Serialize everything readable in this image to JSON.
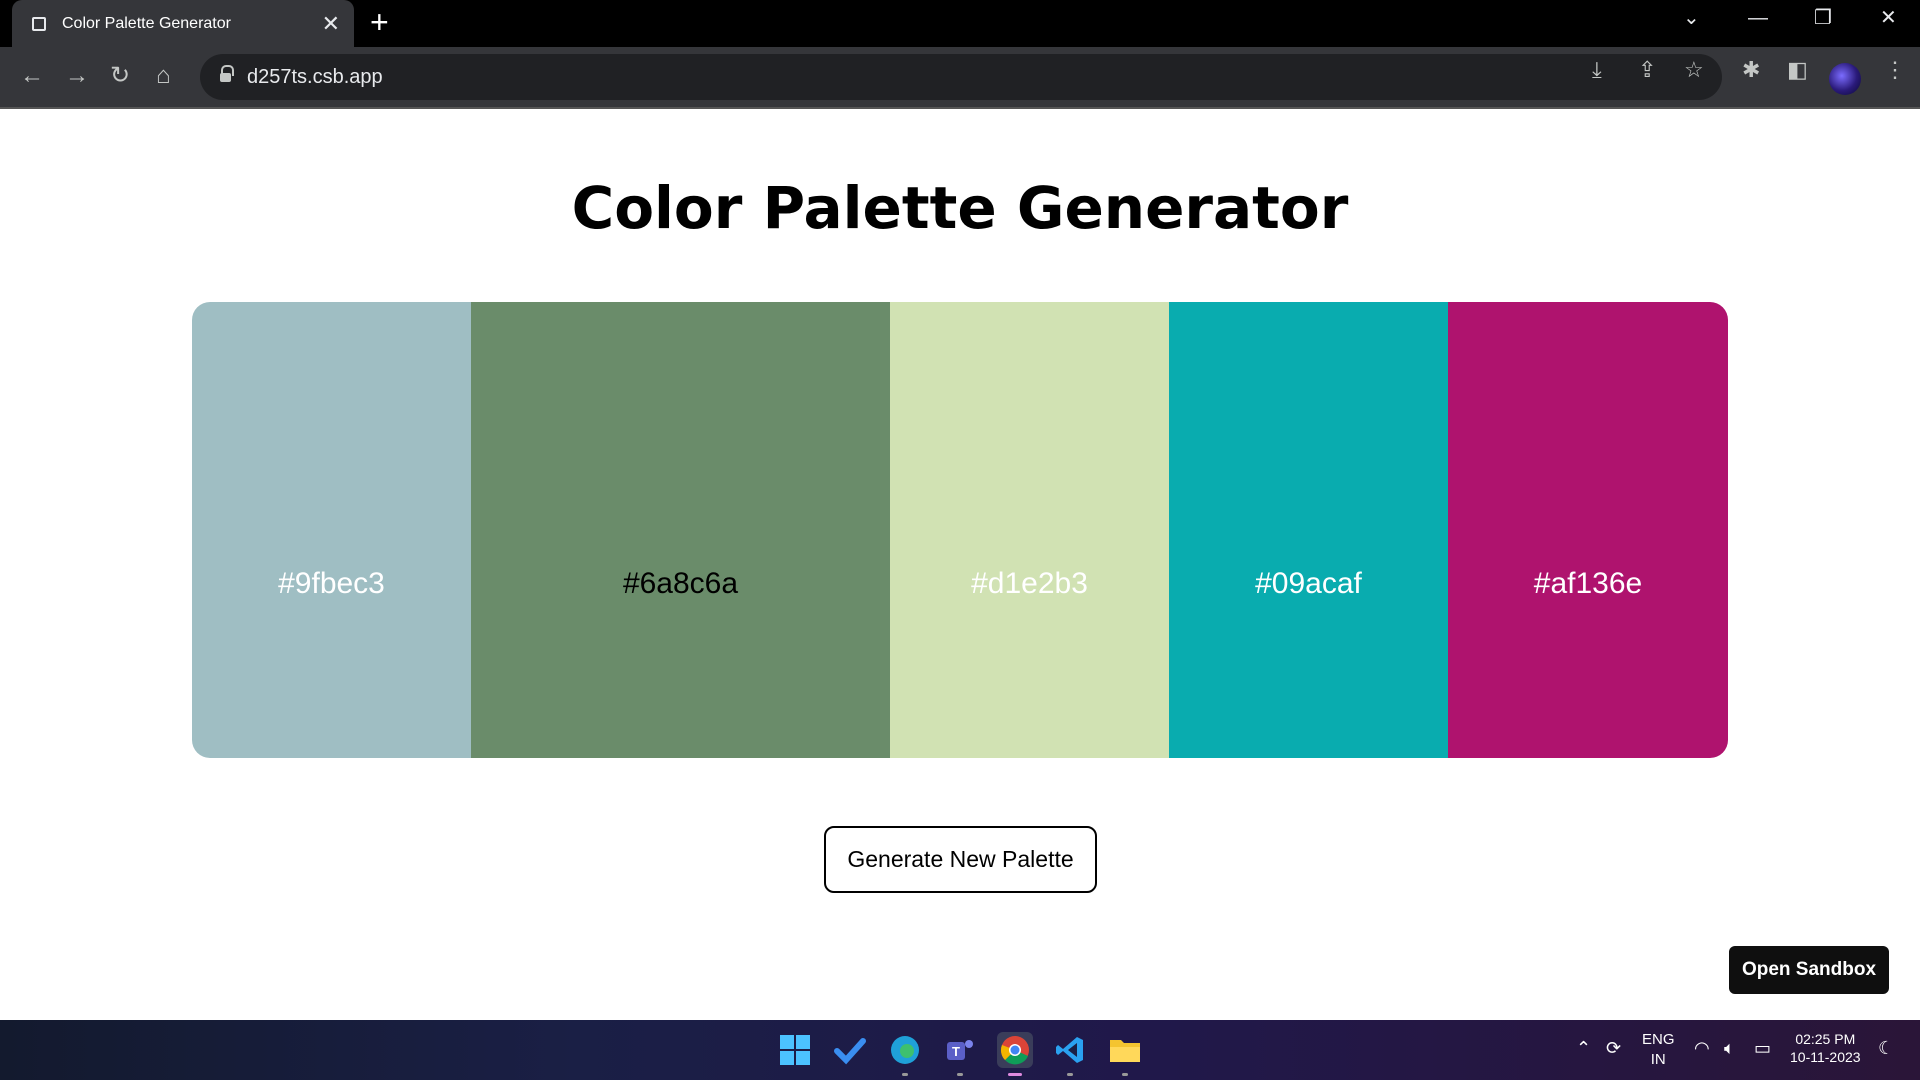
{
  "browser": {
    "tab_title": "Color Palette Generator",
    "url": "d257ts.csb.app"
  },
  "page": {
    "title": "Color Palette Generator",
    "generate_label": "Generate New Palette",
    "sandbox_label": "Open Sandbox"
  },
  "palette": [
    {
      "hex": "#9fbec3",
      "text_color": "#ffffff"
    },
    {
      "hex": "#6a8c6a",
      "text_color": "#000000"
    },
    {
      "hex": "#d1e2b3",
      "text_color": "#ffffff"
    },
    {
      "hex": "#09acaf",
      "text_color": "#ffffff"
    },
    {
      "hex": "#af136e",
      "text_color": "#ffffff"
    }
  ],
  "taskbar": {
    "language_top": "ENG",
    "language_bottom": "IN",
    "time": "02:25 PM",
    "date": "10-11-2023"
  }
}
